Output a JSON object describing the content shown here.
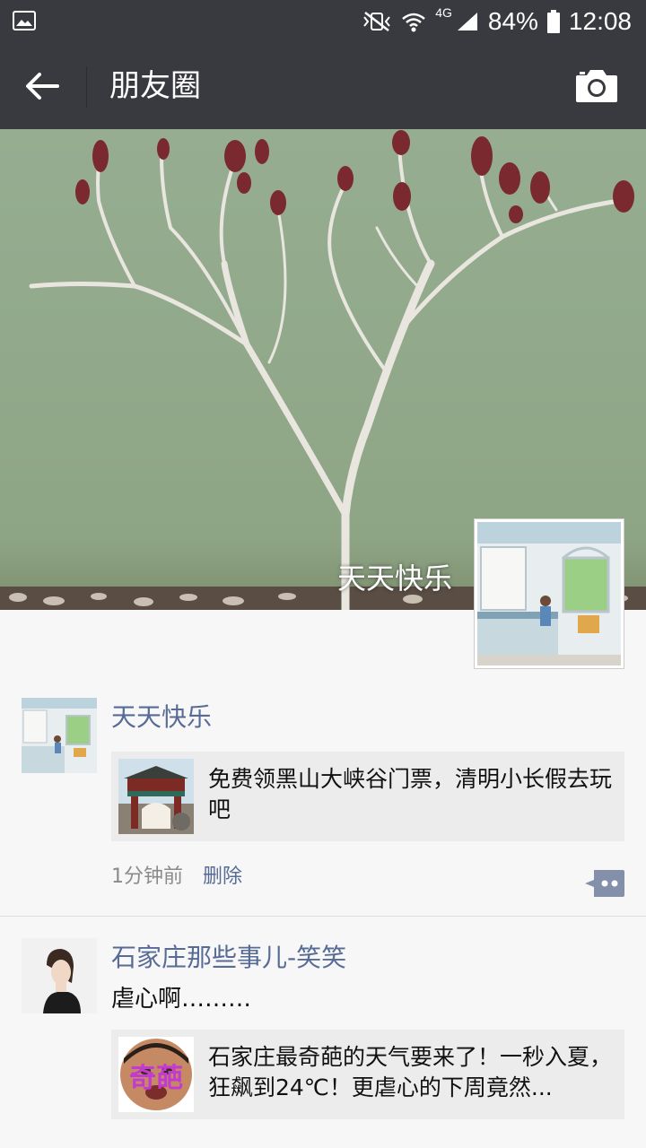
{
  "status_bar": {
    "battery": "84%",
    "time": "12:08",
    "network": "4G"
  },
  "header": {
    "title": "朋友圈",
    "back_icon": "arrow-left-icon",
    "camera_icon": "camera-icon"
  },
  "cover": {
    "username": "天天快乐"
  },
  "posts": [
    {
      "name": "天天快乐",
      "share_text": "免费领黑山大峡谷门票，清明小长假去玩吧",
      "time": "1分钟前",
      "delete_label": "删除"
    },
    {
      "name": "石家庄那些事儿-笑笑",
      "text": "虐心啊………",
      "share_text": "石家庄最奇葩的天气要来了！一秒入夏，狂飙到24℃！更虐心的下周竟然...",
      "thumb_text": "奇葩"
    }
  ],
  "colors": {
    "bar_bg": "#393a3f",
    "name_link": "#576b95",
    "page_bg": "#f7f7f7"
  }
}
